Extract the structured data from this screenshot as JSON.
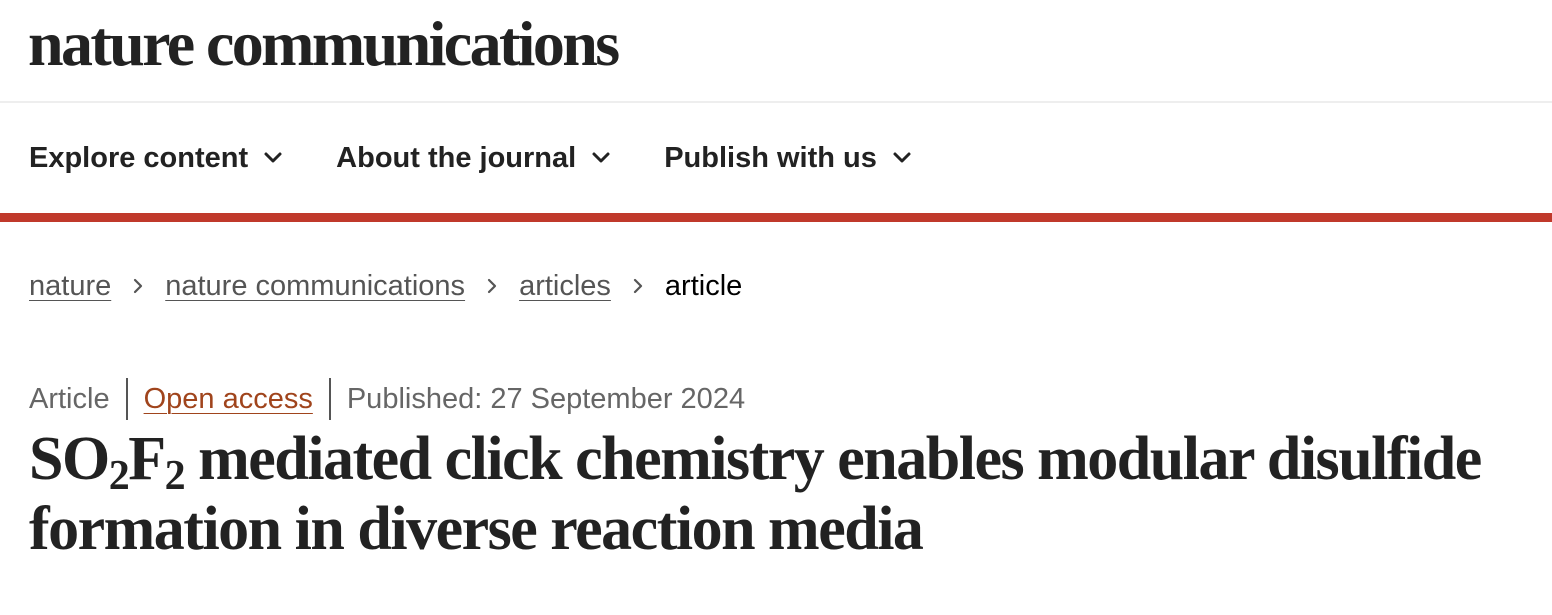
{
  "header": {
    "logo_text": "nature communications"
  },
  "nav": {
    "items": [
      {
        "label": "Explore content"
      },
      {
        "label": "About the journal"
      },
      {
        "label": "Publish with us"
      }
    ]
  },
  "colors": {
    "accent_rule": "#c0392b",
    "open_access_link": "#a0441c",
    "text": "#222222"
  },
  "breadcrumb": {
    "items": [
      {
        "label": "nature",
        "link": true
      },
      {
        "label": "nature communications",
        "link": true
      },
      {
        "label": "articles",
        "link": true
      },
      {
        "label": "article",
        "link": false
      }
    ]
  },
  "article": {
    "type": "Article",
    "access": "Open access",
    "published": "Published: 27 September 2024",
    "title": {
      "part1": "SO",
      "sub1": "2",
      "part2": "F",
      "sub2": "2",
      "part3": " mediated click chemistry enables modular disulfide formation in diverse reaction media"
    }
  },
  "icons": {
    "nav_chevron": "chevron-down-icon",
    "breadcrumb_separator": "chevron-right-icon"
  }
}
